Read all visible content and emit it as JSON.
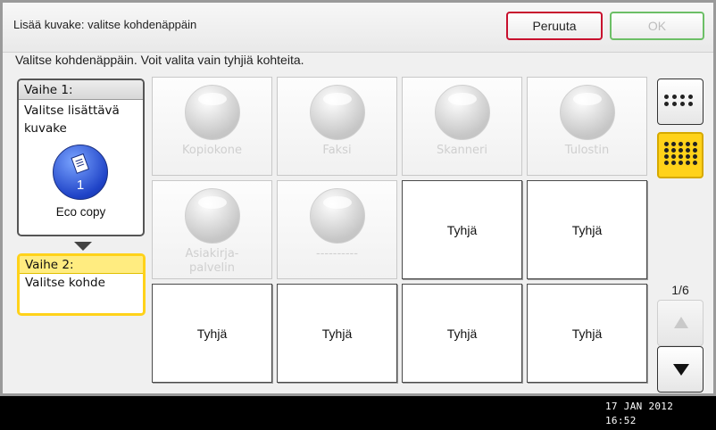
{
  "header": {
    "title": "Lisää kuvake: valitse kohdenäppäin",
    "cancel_label": "Peruuta",
    "ok_label": "OK"
  },
  "instruction": "Valitse kohdenäppäin. Voit valita vain tyhjiä kohteita.",
  "steps": {
    "step1": {
      "heading": "Vaihe 1:",
      "text": "Valitse lisättävä kuvake",
      "icon": "eco-copy-document-icon",
      "icon_number": "1",
      "label": "Eco copy"
    },
    "step2": {
      "heading": "Vaihe 2:",
      "text": "Valitse kohde"
    }
  },
  "grid": {
    "tiles": [
      {
        "label": "Kopiokone",
        "state": "disabled"
      },
      {
        "label": "Faksi",
        "state": "disabled"
      },
      {
        "label": "Skanneri",
        "state": "disabled"
      },
      {
        "label": "Tulostin",
        "state": "disabled"
      },
      {
        "label": "Asiakirja-\npalvelin",
        "state": "disabled"
      },
      {
        "label": "----------",
        "state": "disabled"
      },
      {
        "label": "Tyhjä",
        "state": "empty"
      },
      {
        "label": "Tyhjä",
        "state": "empty"
      },
      {
        "label": "Tyhjä",
        "state": "empty"
      },
      {
        "label": "Tyhjä",
        "state": "empty"
      },
      {
        "label": "Tyhjä",
        "state": "empty"
      },
      {
        "label": "Tyhjä",
        "state": "empty"
      }
    ]
  },
  "pager": {
    "indicator": "1/6"
  },
  "status": {
    "date": "17 JAN  2012",
    "time": "16:52"
  },
  "colors": {
    "cancel_border": "#c8102e",
    "ok_border": "#6cbf66",
    "selected_yellow": "#ffd21a"
  }
}
